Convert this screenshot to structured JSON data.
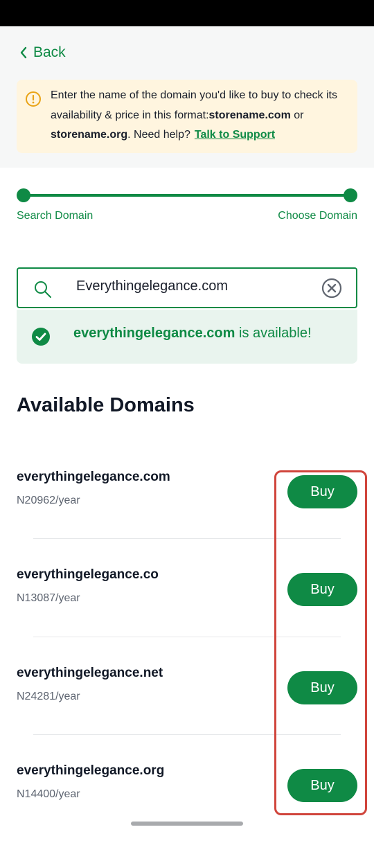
{
  "nav": {
    "back_label": "Back"
  },
  "info": {
    "text_part1": "Enter the name of the domain you'd like to buy to check its availability & price in this format:",
    "example1": "storename.com",
    "text_or": " or ",
    "example2": "storename.org",
    "text_help": ". Need help?",
    "support_link": "Talk to Support"
  },
  "stepper": {
    "step1": "Search Domain",
    "step2": "Choose Domain"
  },
  "search": {
    "value": "Everythingelegance.com"
  },
  "availability": {
    "domain": "everythingelegance.com",
    "suffix": " is available!"
  },
  "section_title": "Available Domains",
  "domains": [
    {
      "name": "everythingelegance.com",
      "price": "N20962/year",
      "action": "Buy"
    },
    {
      "name": "everythingelegance.co",
      "price": "N13087/year",
      "action": "Buy"
    },
    {
      "name": "everythingelegance.net",
      "price": "N24281/year",
      "action": "Buy"
    },
    {
      "name": "everythingelegance.org",
      "price": "N14400/year",
      "action": "Buy"
    }
  ],
  "colors": {
    "primary": "#0f8a45",
    "info_bg": "#fff5df",
    "success_bg": "#e9f4ee",
    "highlight": "#d0453c"
  },
  "icons": [
    "chevron-left-icon",
    "info-icon",
    "search-icon",
    "clear-icon",
    "check-circle-icon"
  ]
}
